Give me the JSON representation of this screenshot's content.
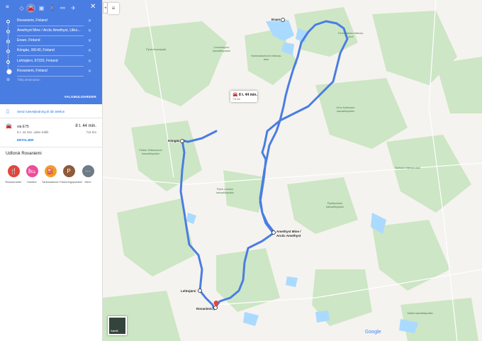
{
  "modes": [
    {
      "icon": "diamond-route-icon"
    },
    {
      "icon": "car-icon",
      "active": true
    },
    {
      "icon": "bus-icon"
    },
    {
      "icon": "walk-icon"
    },
    {
      "icon": "bike-icon"
    },
    {
      "icon": "plane-icon"
    }
  ],
  "stops": [
    "Rovaniemi, Finland",
    "Amethyst Mine / Arctic Amethyst, Ukko...",
    "Enare, Finland",
    "Köngäs, 99140, Finland",
    "Lehtojärvi, 97220, Finland",
    "Rovaniemi, Finland"
  ],
  "add_destination": "Tilføj destination",
  "options_label": "VALGMULIGHEDER",
  "send_label": "Send ruteveijledning til din telefon",
  "route": {
    "via": "via E75",
    "time": "8 t. 44 min.",
    "traffic": "8 t. 44 min. uden trafik",
    "distance": "711 km",
    "details": "DETALJER"
  },
  "explore": {
    "title": "Udforsk Rovaniemi",
    "categories": [
      {
        "label": "Restauranter",
        "color": "#e4443b",
        "glyph": "🍴"
      },
      {
        "label": "Hoteller",
        "color": "#ef4b9b",
        "glyph": "🛏"
      },
      {
        "label": "Tankstationer",
        "color": "#f49d2a",
        "glyph": "⛽"
      },
      {
        "label": "Parkeringspladser",
        "color": "#8d5a3a",
        "glyph": "P"
      },
      {
        "label": "Mere",
        "color": "#6f7b87",
        "glyph": "···"
      }
    ]
  },
  "map": {
    "places": [
      "Enare",
      "Köngäs",
      "Amethyst Mine / Arctic Amethyst",
      "Lehtojärvi",
      "Rovaniemi"
    ],
    "areas": [
      "Pyhä-Kaunispää",
      "Lemmenjoen kansallispuisto",
      "Hammastunturin erämaa-alue",
      "Urho Kekkosen kansallispuisto",
      "Tuntsan erämaa-alue",
      "Pyhätunturin kansallispuisto",
      "Pallas-Yllästunturin kansallispuisto",
      "Kemihaaran erämaa-alue",
      "Pyhä-Luoston kansallispuisto",
      "Sallan kansallispuisto"
    ],
    "callout_time": "8 t. 44 min.",
    "callout_dist": "711 km",
    "satellite_label": "Satellit",
    "logo": "Google",
    "route_color": "#4a7de2"
  }
}
